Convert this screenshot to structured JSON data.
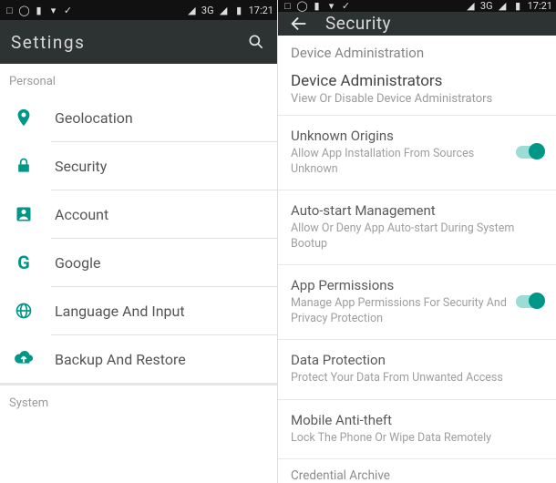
{
  "statusbar": {
    "signal_text": "3G",
    "time": "17:21"
  },
  "left": {
    "title": "Settings",
    "section_personal": "Personal",
    "section_system": "System",
    "items": {
      "geolocation": "Geolocation",
      "security": "Security",
      "account": "Account",
      "google": "Google",
      "language": "Language And Input",
      "backup": "Backup And Restore"
    }
  },
  "right": {
    "title": "Security",
    "section": "Device Administration",
    "device_admin": {
      "title": "Device Administrators",
      "sub": "View Or Disable Device Administrators"
    },
    "unknown": {
      "title": "Unknown Origins",
      "sub": "Allow App Installation From Sources Unknown"
    },
    "autostart": {
      "title": "Auto-start Management",
      "sub": "Allow Or Deny App Auto-start During System Bootup"
    },
    "permissions": {
      "title": "App Permissions",
      "sub": "Manage App Permissions For Security And Privacy Protection"
    },
    "dataprotect": {
      "title": "Data Protection",
      "sub": "Protect Your Data From Unwanted Access"
    },
    "antitheft": {
      "title": "Mobile Anti-theft",
      "sub": "Lock The Phone Or Wipe Data Remotely"
    },
    "credarchive": {
      "title": "Credential Archive"
    }
  }
}
